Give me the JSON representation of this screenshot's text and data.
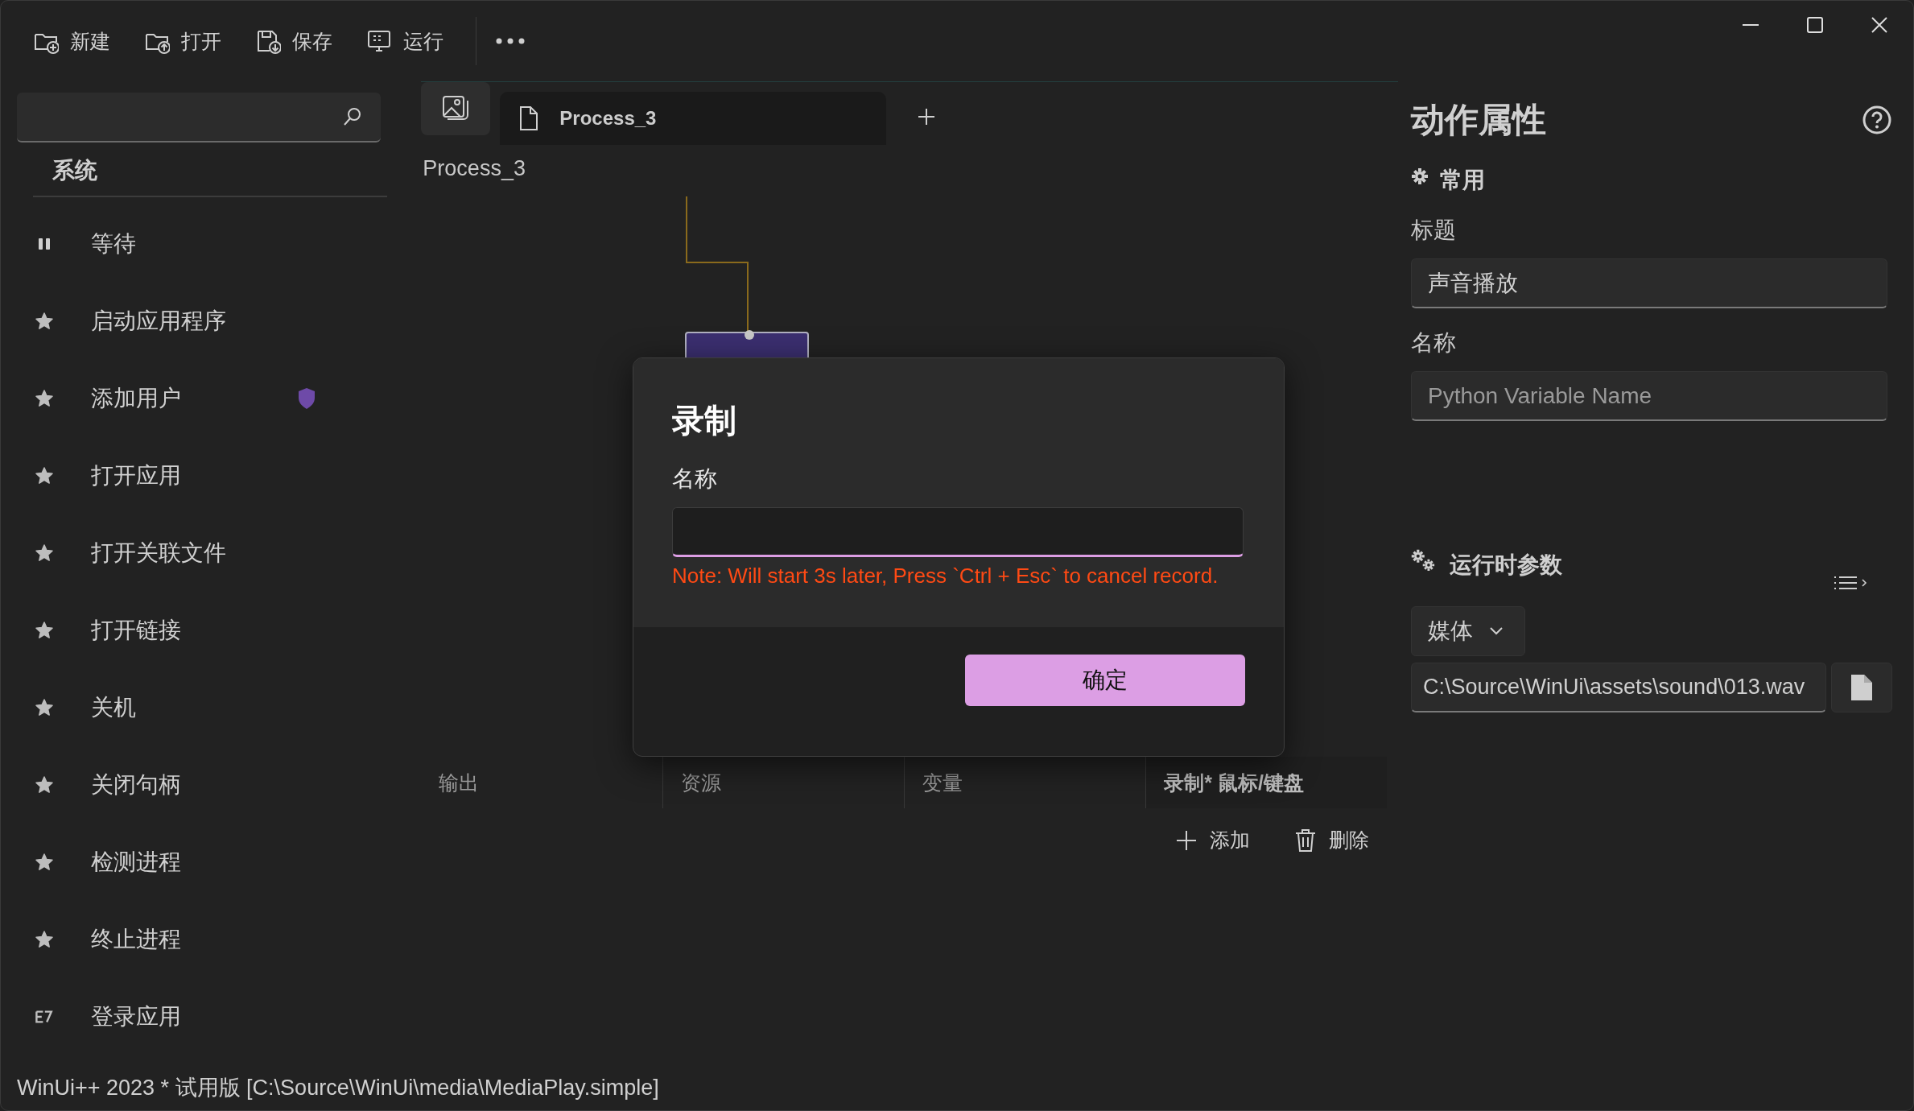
{
  "toolbar": {
    "buttons": [
      {
        "label": "新建",
        "kind": "new"
      },
      {
        "label": "打开",
        "kind": "open"
      },
      {
        "label": "保存",
        "kind": "save"
      },
      {
        "label": "运行",
        "kind": "run"
      }
    ]
  },
  "sidebar": {
    "section": "系统",
    "items": [
      {
        "label": "等待",
        "kind": "pause",
        "shield": false
      },
      {
        "label": "启动应用程序",
        "kind": "star",
        "shield": false
      },
      {
        "label": "添加用户",
        "kind": "star",
        "shield": true
      },
      {
        "label": "打开应用",
        "kind": "star",
        "shield": false
      },
      {
        "label": "打开关联文件",
        "kind": "star",
        "shield": false
      },
      {
        "label": "打开链接",
        "kind": "star",
        "shield": false
      },
      {
        "label": "关机",
        "kind": "star",
        "shield": false
      },
      {
        "label": "关闭句柄",
        "kind": "star",
        "shield": false
      },
      {
        "label": "检测进程",
        "kind": "star",
        "shield": false
      },
      {
        "label": "终止进程",
        "kind": "star",
        "shield": false
      },
      {
        "label": "登录应用",
        "kind": "e7",
        "shield": false
      }
    ]
  },
  "tabs": [
    {
      "label": "Process_3",
      "selected": true
    }
  ],
  "canvas": {
    "title": "Process_3"
  },
  "bottom_panel": {
    "tabs": [
      {
        "label": "输出",
        "selected": false
      },
      {
        "label": "资源",
        "selected": false
      },
      {
        "label": "变量",
        "selected": false
      },
      {
        "label": "录制* 鼠标/键盘",
        "selected": true
      }
    ],
    "actions": [
      {
        "label": "添加",
        "kind": "add"
      },
      {
        "label": "删除",
        "kind": "delete"
      }
    ]
  },
  "dialog": {
    "title": "录制",
    "field_label": "名称",
    "note": "Note: Will start 3s later, Press `Ctrl + Esc` to cancel record.",
    "button": "确定"
  },
  "properties": {
    "title": "动作属性",
    "general": {
      "heading": "常用",
      "fields": [
        {
          "label": "标题",
          "value": "声音播放"
        },
        {
          "label": "名称",
          "placeholder": "Python Variable Name"
        }
      ]
    },
    "runtime": {
      "heading": "运行时参数",
      "dropdown": "媒体",
      "path": "C:\\Source\\WinUi\\assets\\sound\\013.wav"
    }
  },
  "status_bar": "WinUi++ 2023 * 试用版 [C:\\Source\\WinUi\\media\\MediaPlay.simple]"
}
